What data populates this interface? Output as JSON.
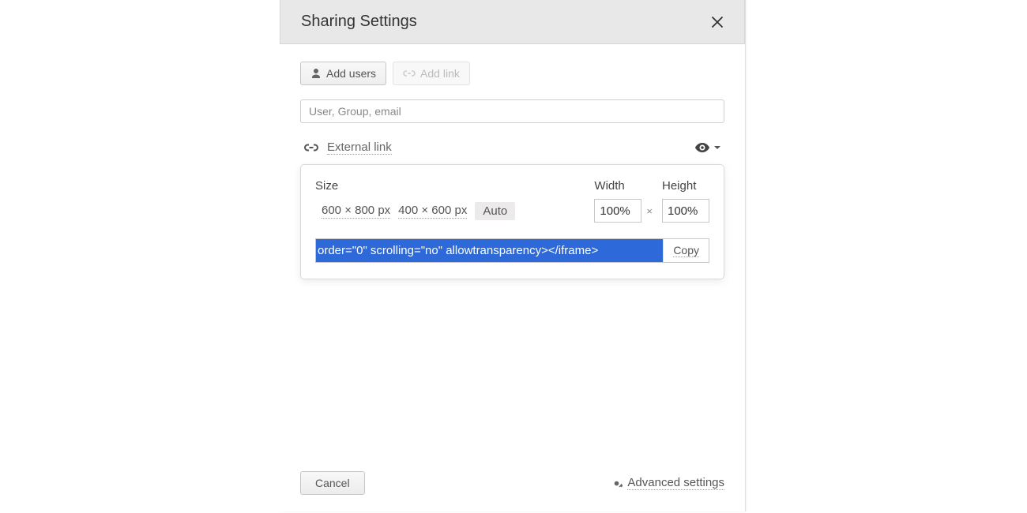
{
  "header": {
    "title": "Sharing Settings"
  },
  "actions": {
    "add_users": "Add users",
    "add_link": "Add link"
  },
  "search": {
    "placeholder": "User, Group, email"
  },
  "external_link": {
    "label": "External link"
  },
  "embed": {
    "size_label": "Size",
    "presets": {
      "p1": "600 × 800 px",
      "p2": "400 × 600 px",
      "auto": "Auto"
    },
    "width_label": "Width",
    "height_label": "Height",
    "width_value": "100%",
    "height_value": "100%",
    "multiply": "×",
    "code_visible": "order=\"0\" scrolling=\"no\" allowtransparency></iframe>",
    "copy_label": "Copy"
  },
  "footer": {
    "cancel": "Cancel",
    "advanced": "Advanced settings"
  }
}
